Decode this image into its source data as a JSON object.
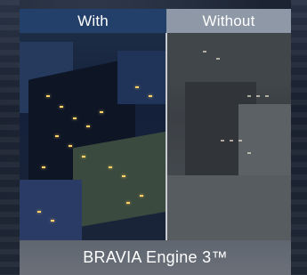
{
  "comparison": {
    "with_label": "With",
    "without_label": "Without"
  },
  "caption": {
    "text": "BRAVIA Engine 3™"
  },
  "colors": {
    "with_tab": "#23406a",
    "without_tab": "#8e98a6",
    "caption_bar": "#676c75"
  }
}
